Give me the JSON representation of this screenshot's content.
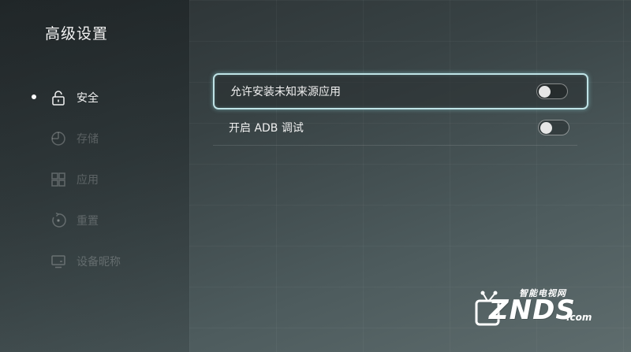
{
  "page": {
    "title": "高级设置"
  },
  "sidebar": {
    "items": [
      {
        "label": "安全",
        "icon": "unlock-icon",
        "active": true
      },
      {
        "label": "存储",
        "icon": "storage-icon",
        "active": false
      },
      {
        "label": "应用",
        "icon": "apps-grid-icon",
        "active": false
      },
      {
        "label": "重置",
        "icon": "reset-icon",
        "active": false
      },
      {
        "label": "设备昵称",
        "icon": "monitor-icon",
        "active": false
      }
    ]
  },
  "settings": {
    "items": [
      {
        "label": "允许安装未知来源应用",
        "toggle_on": false
      },
      {
        "label": "开启 ADB 调试",
        "toggle_on": false
      }
    ]
  },
  "watermark": {
    "top_text": "智能电视网",
    "main_text": "ZNDS",
    "suffix": ".com"
  },
  "colors": {
    "focus_border": "#bfe3e6",
    "background": "#3a4446"
  }
}
